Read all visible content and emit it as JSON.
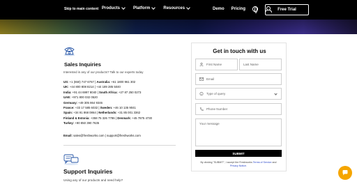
{
  "nav": {
    "skip_link": "Skip to main content",
    "links": [
      "Products",
      "Platform",
      "Resources"
    ],
    "demo": "Demo",
    "pricing": "Pricing",
    "free_trial": "Free Trial"
  },
  "sales": {
    "title": "Sales Inquiries",
    "intro": "Interested in any of our products? Talk to our experts today",
    "lines": [
      {
        "label1": "US:",
        "value1": "+1 (650) 747 6767",
        "label2": "Australia:",
        "value2": "+61 1800 961 302"
      },
      {
        "label1": "UK:",
        "value1": "+44 800 808 8214",
        "label2": "",
        "value2": "+44 189 285 5040"
      },
      {
        "label1": "India:",
        "value1": "+91 44 6997 8040",
        "label2": "South Africa:",
        "value2": "+27 87 250 0273"
      },
      {
        "label1": "UAE:",
        "value1": "+971 800 032 0520",
        "label2": "",
        "value2": ""
      },
      {
        "label1": "Germany:",
        "value1": "+49 305 864 9346",
        "label2": "",
        "value2": ""
      },
      {
        "label1": "France:",
        "value1": "+33 17 585 6032",
        "label2": "Sweden:",
        "value2": "+46 10 135 9041"
      },
      {
        "label1": "Spain:",
        "value1": "+34 91 868 0864",
        "label2": "Netherlands:",
        "value2": "+31 85 001 3362"
      },
      {
        "label1": "Finland & Estonia:",
        "value1": "+358 75 326 7786",
        "label2": "Denmark:",
        "value2": "+45 7875 4730"
      },
      {
        "label1": "Turkey:",
        "value1": "+90 850 390 7635",
        "label2": "",
        "value2": ""
      }
    ],
    "email_label": "Email:",
    "email_value": "sales@freshworks.com | support@freshworks.com"
  },
  "support": {
    "title": "Support Inquiries",
    "text": "Using any of our products and need help?"
  },
  "form": {
    "title": "Get in touch with us",
    "first_name": "First Name",
    "last_name": "Last Name",
    "email": "Email",
    "query_type": "Type of query",
    "phone": "Phone Number",
    "message": "Your message",
    "submit": "SUBMIT",
    "consent_prefix": "By clicking \"SUBMIT\", I accept the Freshworks",
    "terms": "Terms of Service",
    "and": "and",
    "privacy": "Privacy Notice."
  },
  "colors": {
    "accent": "#f5a500",
    "link": "#2a46c9",
    "icon_blue": "#2454a6"
  }
}
